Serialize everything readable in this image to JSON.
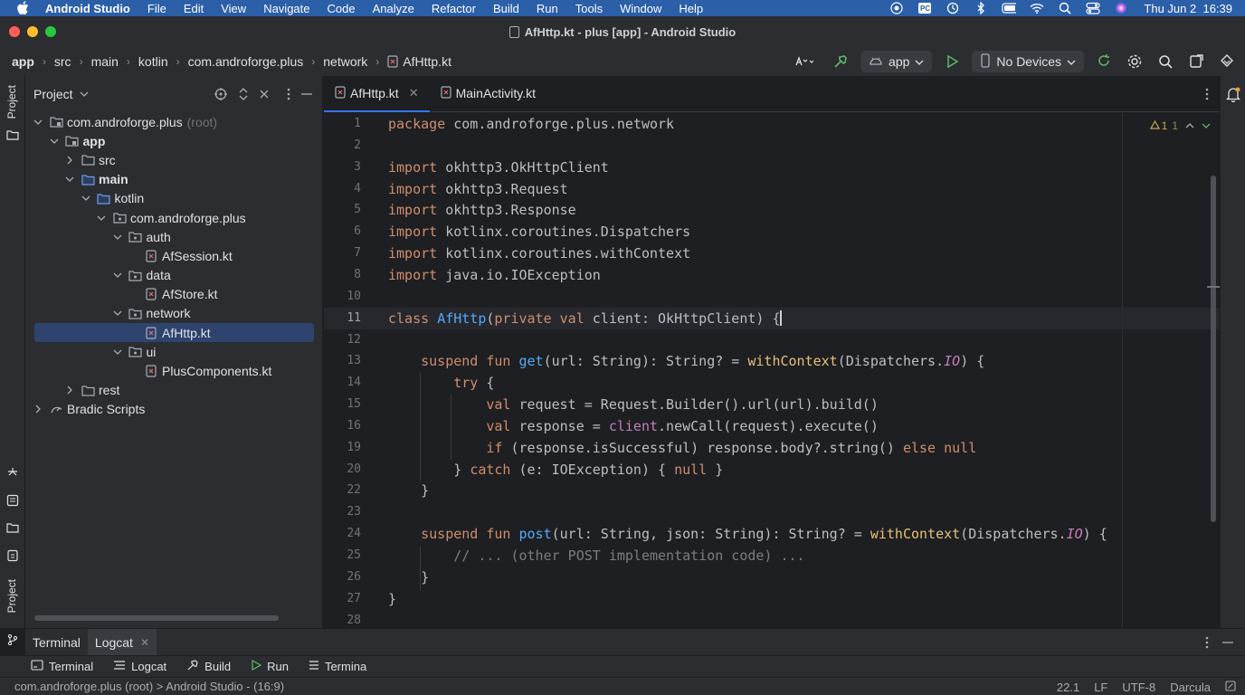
{
  "menubar": {
    "app_name": "Android Studio",
    "items": [
      "File",
      "Edit",
      "View",
      "Navigate",
      "Code",
      "Analyze",
      "Refactor",
      "Build",
      "Run",
      "Tools",
      "Window",
      "Help"
    ],
    "clock": "Thu Jun 2  16:39",
    "status_icons": [
      "record-icon",
      "pc-icon",
      "time-machine-icon",
      "bluetooth-icon",
      "battery-icon",
      "wifi-icon",
      "spotlight-icon",
      "control-center-icon",
      "siri-icon"
    ]
  },
  "window": {
    "title": "AfHttp.kt - plus [app] - Android Studio",
    "traffic_colors": [
      "#ff5f57",
      "#febc2e",
      "#28c840"
    ]
  },
  "toolbar": {
    "breadcrumbs": [
      "app",
      "src",
      "main",
      "kotlin",
      "com.androforge.plus",
      "network",
      "AfHttp.kt"
    ],
    "run_config": "app",
    "device": "No Devices"
  },
  "left_strip": {
    "project_label": "Project",
    "bottom_label": "Project"
  },
  "project_panel": {
    "title": "Project",
    "tree": [
      {
        "label": "com.androforge.plus",
        "suffix": "(root)",
        "depth": 0,
        "expanded": true,
        "icon": "module-icon"
      },
      {
        "label": "app",
        "depth": 1,
        "expanded": true,
        "icon": "module-icon",
        "bold": true
      },
      {
        "label": "src",
        "depth": 2,
        "expanded": false,
        "icon": "folder-icon"
      },
      {
        "label": "main",
        "depth": 2,
        "expanded": true,
        "icon": "source-folder-icon",
        "bold": true
      },
      {
        "label": "kotlin",
        "depth": 3,
        "expanded": true,
        "icon": "source-folder-icon"
      },
      {
        "label": "com.androforge.plus",
        "depth": 4,
        "expanded": true,
        "icon": "package-icon"
      },
      {
        "label": "auth",
        "depth": 5,
        "expanded": true,
        "icon": "package-icon"
      },
      {
        "label": "AfSession.kt",
        "depth": 6,
        "icon": "kotlin-file-icon"
      },
      {
        "label": "data",
        "depth": 5,
        "expanded": true,
        "icon": "package-icon"
      },
      {
        "label": "AfStore.kt",
        "depth": 6,
        "icon": "kotlin-file-icon"
      },
      {
        "label": "network",
        "depth": 5,
        "expanded": true,
        "icon": "package-icon"
      },
      {
        "label": "AfHttp.kt",
        "depth": 6,
        "icon": "kotlin-file-icon",
        "selected": true
      },
      {
        "label": "ui",
        "depth": 5,
        "expanded": true,
        "icon": "package-icon"
      },
      {
        "label": "PlusComponents.kt",
        "depth": 6,
        "icon": "kotlin-file-icon"
      },
      {
        "label": "rest",
        "depth": 2,
        "expanded": false,
        "icon": "folder-icon"
      },
      {
        "label": "Bradic Scripts",
        "depth": 0,
        "expanded": false,
        "icon": "gradle-icon"
      }
    ]
  },
  "editor": {
    "tabs": [
      {
        "label": "AfHttp.kt",
        "active": true
      },
      {
        "label": "MainActivity.kt",
        "active": false
      }
    ],
    "inspection": {
      "warnings": "1",
      "hints": "1"
    },
    "current_line": "11",
    "lines": [
      {
        "n": "1",
        "tokens": [
          [
            "kw",
            "package"
          ],
          [
            "",
            " com.androforge.plus.network"
          ]
        ]
      },
      {
        "n": "2",
        "tokens": []
      },
      {
        "n": "3",
        "tokens": [
          [
            "kw",
            "import"
          ],
          [
            "",
            " okhttp3.OkHttpClient"
          ]
        ]
      },
      {
        "n": "4",
        "tokens": [
          [
            "kw",
            "import"
          ],
          [
            "",
            " okhttp3.Request"
          ]
        ]
      },
      {
        "n": "5",
        "tokens": [
          [
            "kw",
            "import"
          ],
          [
            "",
            " okhttp3.Response"
          ]
        ]
      },
      {
        "n": "6",
        "tokens": [
          [
            "kw",
            "import"
          ],
          [
            "",
            " kotlinx.coroutines.Dispatchers"
          ]
        ]
      },
      {
        "n": "7",
        "tokens": [
          [
            "kw",
            "import"
          ],
          [
            "",
            " kotlinx.coroutines.withContext"
          ]
        ]
      },
      {
        "n": "8",
        "tokens": [
          [
            "kw",
            "import"
          ],
          [
            "",
            " java.io.IOException"
          ]
        ]
      },
      {
        "n": "10",
        "tokens": []
      },
      {
        "n": "11",
        "tokens": [
          [
            "kw",
            "class "
          ],
          [
            "fn",
            "AfHttp"
          ],
          [
            "",
            "("
          ],
          [
            "kw",
            "private val "
          ],
          [
            "",
            "client: OkHttpClient) "
          ],
          [
            "",
            "{"
          ]
        ]
      },
      {
        "n": "12",
        "tokens": []
      },
      {
        "n": "13",
        "tokens": [
          [
            "",
            "    "
          ],
          [
            "kw",
            "suspend fun "
          ],
          [
            "fn",
            "get"
          ],
          [
            "",
            "(url: String): String? = "
          ],
          [
            "fnw",
            "withContext"
          ],
          [
            "",
            "(Dispatchers."
          ],
          [
            "ital",
            "IO"
          ],
          [
            "",
            ") {"
          ]
        ]
      },
      {
        "n": "14",
        "tokens": [
          [
            "",
            "        "
          ],
          [
            "kw",
            "try"
          ],
          [
            "",
            " {"
          ]
        ]
      },
      {
        "n": "15",
        "tokens": [
          [
            "",
            "            "
          ],
          [
            "kw",
            "val "
          ],
          [
            "",
            "request = Request.Builder().url(url).build()"
          ]
        ]
      },
      {
        "n": "16",
        "tokens": [
          [
            "",
            "            "
          ],
          [
            "kw",
            "val "
          ],
          [
            "",
            "response = "
          ],
          [
            "tyu",
            "client"
          ],
          [
            "",
            ".newCall(request).execute()"
          ]
        ]
      },
      {
        "n": "19",
        "tokens": [
          [
            "",
            "            "
          ],
          [
            "kw",
            "if "
          ],
          [
            "",
            "(response.isSuccessful) response.body?.string() "
          ],
          [
            "kw",
            "else null"
          ]
        ]
      },
      {
        "n": "20",
        "tokens": [
          [
            "",
            "        } "
          ],
          [
            "kw",
            "catch "
          ],
          [
            "",
            "(e: IOException) { "
          ],
          [
            "kw",
            "null"
          ],
          [
            "",
            " }"
          ]
        ]
      },
      {
        "n": "22",
        "tokens": [
          [
            "",
            "    }"
          ]
        ]
      },
      {
        "n": "23",
        "tokens": []
      },
      {
        "n": "24",
        "tokens": [
          [
            "",
            "    "
          ],
          [
            "kw",
            "suspend fun "
          ],
          [
            "fn",
            "post"
          ],
          [
            "",
            "(url: String, json: String): String? = "
          ],
          [
            "fnw",
            "withContext"
          ],
          [
            "",
            "(Dispatchers."
          ],
          [
            "ital",
            "IO"
          ],
          [
            "",
            ") {"
          ]
        ]
      },
      {
        "n": "25",
        "tokens": [
          [
            "",
            "        "
          ],
          [
            "cm",
            "// ... (other POST implementation code) ..."
          ]
        ]
      },
      {
        "n": "26",
        "tokens": [
          [
            "",
            "    }"
          ]
        ]
      },
      {
        "n": "27",
        "tokens": [
          [
            "",
            "}"
          ]
        ]
      },
      {
        "n": "28",
        "tokens": []
      }
    ]
  },
  "bottom_panel": {
    "tabs": [
      "Terminal",
      "Logcat"
    ],
    "tool_windows": [
      "Terminal",
      "Logcat",
      "Build",
      "Run",
      "Termina"
    ]
  },
  "statusbar": {
    "left": "com.androforge.plus (root) > Android Studio - (16:9)",
    "position": "22.1",
    "line_sep": "LF",
    "encoding": "UTF-8",
    "theme": "Darcula"
  },
  "colors": {
    "menubar_bg": "#2b5fa8",
    "accent": "#3574f0",
    "keyword": "#cf8e6d",
    "function": "#56a8f5",
    "comment": "#7a7e85"
  }
}
